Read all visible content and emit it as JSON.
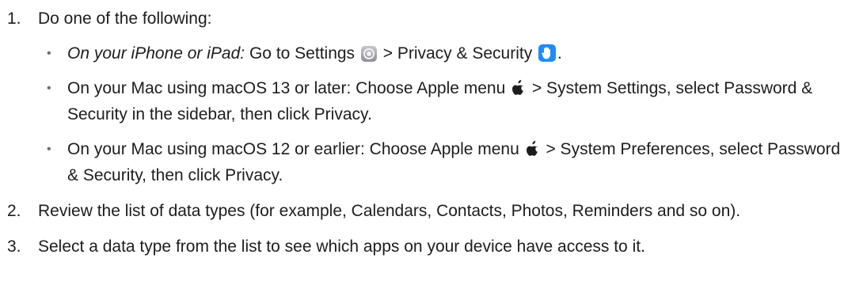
{
  "steps": [
    {
      "num": "1.",
      "text": "Do one of the following:",
      "subs": [
        {
          "bullet": "•",
          "lead_italic": "On your iPhone or iPad:",
          "part1": " Go to Settings ",
          "part2": " > Privacy & Security ",
          "tail": ".",
          "icons": [
            "settings-icon",
            "privacy-hand-icon"
          ]
        },
        {
          "bullet": "•",
          "part1": "On your Mac using macOS 13 or later: Choose Apple menu ",
          "part2": " > System Settings, select Password & Security in the sidebar, then click Privacy.",
          "icons": [
            "apple-icon"
          ]
        },
        {
          "bullet": "•",
          "part1": "On your Mac using macOS 12 or earlier: Choose Apple menu ",
          "part2": " > System Preferences, select Password & Security, then click Privacy.",
          "icons": [
            "apple-icon"
          ]
        }
      ]
    },
    {
      "num": "2.",
      "text": "Review the list of data types (for example, Calendars, Contacts, Photos, Reminders and so on)."
    },
    {
      "num": "3.",
      "text": "Select a data type from the list to see which apps on your device have access to it."
    }
  ],
  "colors": {
    "text": "#1d1d1f",
    "privacy_icon_bg": "#1f8cf5",
    "settings_icon_bg": "#8e8e93"
  }
}
